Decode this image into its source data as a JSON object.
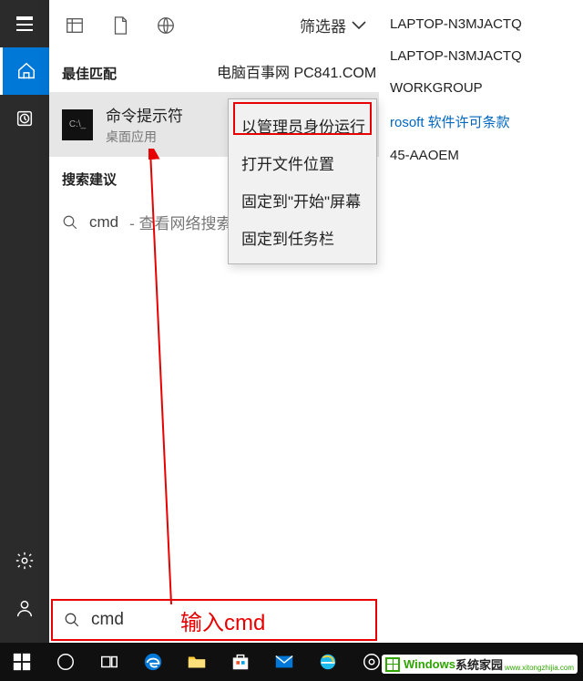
{
  "sidebar": {
    "items": [
      "menu",
      "home",
      "clock",
      "gear",
      "user"
    ]
  },
  "header": {
    "filter_label": "筛选器"
  },
  "watermark_top": "电脑百事网 PC841.COM",
  "best_match_label": "最佳匹配",
  "result": {
    "title": "命令提示符",
    "subtitle": "桌面应用",
    "icon_text": "C:\\_"
  },
  "suggest_label": "搜索建议",
  "suggest": {
    "query": "cmd",
    "hint": " - 查看网络搜索结果"
  },
  "context_menu": {
    "items": [
      "以管理员身份运行",
      "打开文件位置",
      "固定到\"开始\"屏幕",
      "固定到任务栏"
    ]
  },
  "search": {
    "value": "cmd",
    "caption": "输入cmd"
  },
  "bg": {
    "line1": "LAPTOP-N3MJACTQ",
    "line2": "LAPTOP-N3MJACTQ",
    "line3": "WORKGROUP",
    "link": "rosoft 软件许可条款",
    "line5": "45-AAOEM"
  },
  "watermark_br": {
    "brand_en": "Windows",
    "brand_cn": "系统家园",
    "url": "www.xitongzhijia.com"
  },
  "taskbar": {
    "items": [
      "start",
      "cortana",
      "taskview",
      "edge",
      "explorer",
      "store",
      "mail",
      "ie",
      "settings"
    ]
  }
}
